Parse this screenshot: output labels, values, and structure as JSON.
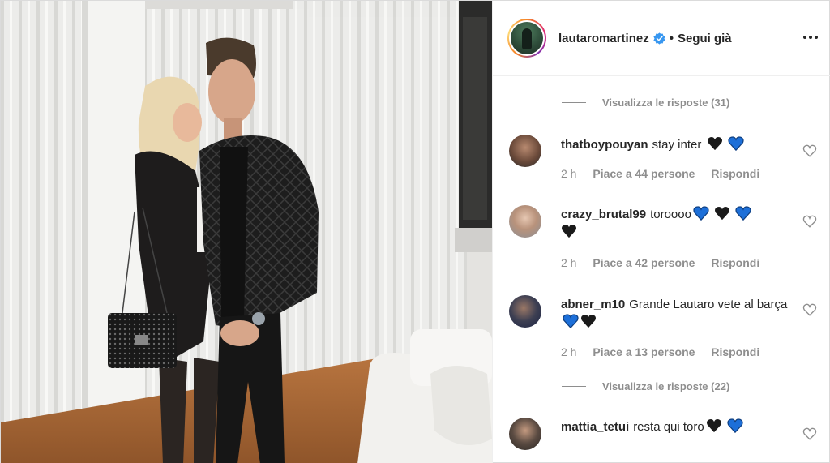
{
  "header": {
    "username": "lautaromartinez",
    "separator": "•",
    "follow_label": "Segui già",
    "more_icon": "more-horizontal-icon"
  },
  "view_replies": [
    {
      "label": "Visualizza le risposte (31)"
    },
    {
      "label": "Visualizza le risposte (22)"
    }
  ],
  "comments": [
    {
      "user": "thatboypouyan",
      "text": "stay inter",
      "time": "2 h",
      "likes": "Piace a 44 persone",
      "reply": "Rispondi",
      "emojis": [
        "black-heart",
        "blue-heart"
      ]
    },
    {
      "user": "crazy_brutal99",
      "text": "toroooo",
      "time": "2 h",
      "likes": "Piace a 42 persone",
      "reply": "Rispondi",
      "emojis": [
        "blue-heart",
        "black-heart",
        "blue-heart",
        "black-heart"
      ]
    },
    {
      "user": "abner_m10",
      "text": "Grande Lautaro vete al barça",
      "time": "2 h",
      "likes": "Piace a 13 persone",
      "reply": "Rispondi",
      "emojis": [
        "blue-heart",
        "black-heart"
      ]
    },
    {
      "user": "mattia_tetui",
      "text": "resta qui toro",
      "emojis": [
        "black-heart",
        "blue-heart"
      ]
    }
  ],
  "colors": {
    "text": "#262626",
    "muted": "#8e8e8e",
    "verified": "#3897f0",
    "blue_heart": "#1d6fd8",
    "black_heart": "#1a1a1a"
  }
}
